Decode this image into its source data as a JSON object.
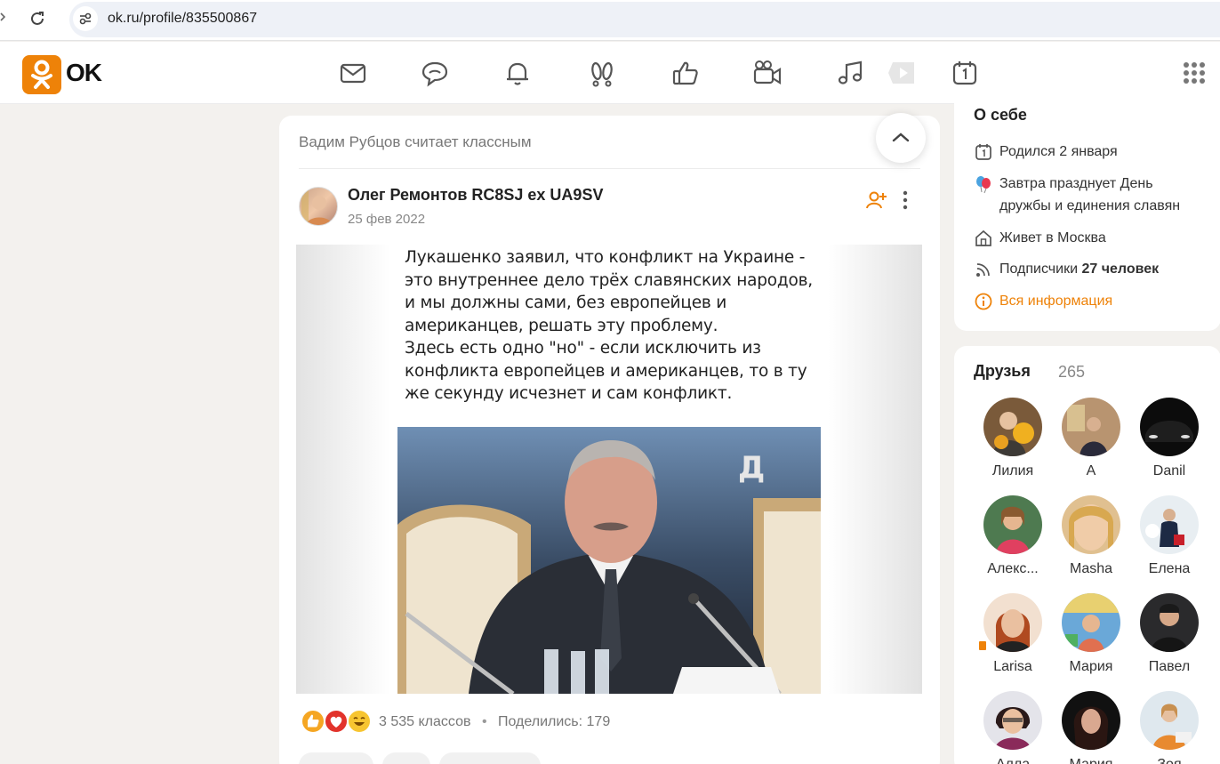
{
  "browser": {
    "url": "ok.ru/profile/835500867"
  },
  "header": {
    "logo_text": "OK",
    "brand_color": "#ee8208",
    "nav_icons": [
      "mail-icon",
      "chat-icon",
      "bell-icon",
      "guests-icon",
      "like-icon",
      "video-camera-icon",
      "music-icon",
      "video-play-icon",
      "calendar-icon"
    ]
  },
  "feed": {
    "liked_by": "Вадим Рубцов считает классным",
    "author_name": "Олег Ремонтов RC8SJ ex UA9SV",
    "post_date": "25 фев 2022",
    "meme_text": "Лукашенко заявил, что конфликт на Украине - это внутреннее дело трёх славянских народов, и мы должны сами, без европейцев и американцев, решать эту проблему.\nЗдесь есть одно \"но\" - если исключить из конфликта европейцев и американцев, то в ту же секунду исчезнет и сам конфликт.",
    "meme_watermark": "Д",
    "likes_text": "3 535 классов",
    "dot": "•",
    "shares_text": "Поделились: 179"
  },
  "about": {
    "title": "О себе",
    "birthday": "Родился 2 января",
    "holiday": "Завтра празднует День дружбы и единения славян",
    "city": "Живет в Москва",
    "subscribers_label": "Подписчики",
    "subscribers_value": "27 человек",
    "all_info": "Вся информация"
  },
  "friends": {
    "title": "Друзья",
    "count": "265",
    "items": [
      {
        "name": "Лилия"
      },
      {
        "name": "А"
      },
      {
        "name": "Danil"
      },
      {
        "name": "Алекс..."
      },
      {
        "name": "Masha"
      },
      {
        "name": "Елена"
      },
      {
        "name": "Larisa"
      },
      {
        "name": "Мария"
      },
      {
        "name": "Павел"
      },
      {
        "name": "Алла"
      },
      {
        "name": "Мария"
      },
      {
        "name": "Зоя"
      }
    ]
  }
}
